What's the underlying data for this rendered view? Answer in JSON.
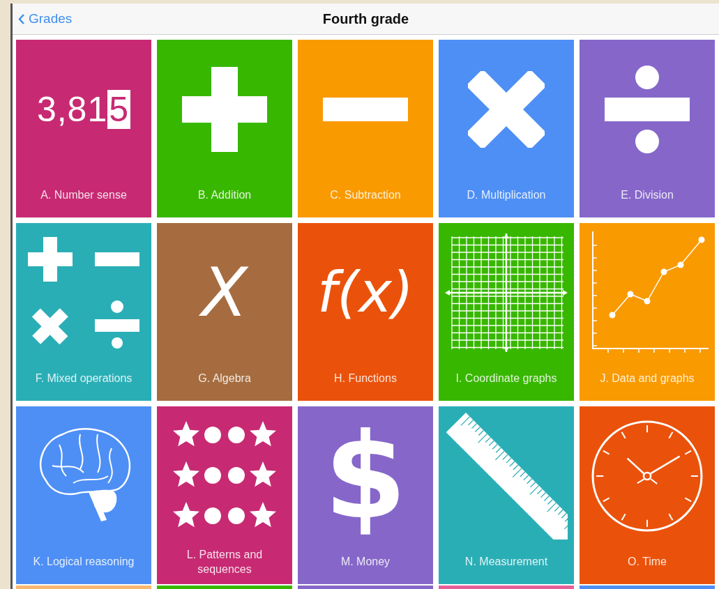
{
  "nav": {
    "back": "Grades",
    "title": "Fourth grade"
  },
  "tiles": [
    {
      "label": "A. Number sense",
      "color": "#c72a72",
      "kind": "number",
      "number": "3,81",
      "highlight": "5"
    },
    {
      "label": "B. Addition",
      "color": "#38b700",
      "kind": "plus"
    },
    {
      "label": "C. Subtraction",
      "color": "#f99a00",
      "kind": "minus"
    },
    {
      "label": "D. Multiplication",
      "color": "#4e8ff5",
      "kind": "times"
    },
    {
      "label": "E. Division",
      "color": "#8667c9",
      "kind": "divide"
    },
    {
      "label": "F. Mixed operations",
      "color": "#2aaeb6",
      "kind": "mixed"
    },
    {
      "label": "G. Algebra",
      "color": "#a66c3f",
      "kind": "symbol",
      "symbol": "X"
    },
    {
      "label": "H. Functions",
      "color": "#ea520b",
      "kind": "symbol",
      "symbol": "f(x)"
    },
    {
      "label": "I. Coordinate graphs",
      "color": "#38b700",
      "kind": "grid"
    },
    {
      "label": "J. Data and graphs",
      "color": "#f99a00",
      "kind": "chart"
    },
    {
      "label": "K. Logical reasoning",
      "color": "#4e8ff5",
      "kind": "brain"
    },
    {
      "label": "L. Patterns and sequences",
      "color": "#c72a72",
      "kind": "pattern"
    },
    {
      "label": "M. Money",
      "color": "#8667c9",
      "kind": "symbol",
      "symbol": "$"
    },
    {
      "label": "N. Measurement",
      "color": "#2aaeb6",
      "kind": "ruler"
    },
    {
      "label": "O. Time",
      "color": "#ea520b",
      "kind": "clock"
    }
  ],
  "partial_tiles": [
    {
      "color": "#f9b870"
    },
    {
      "color": "#38b700"
    },
    {
      "color": "#8667c9"
    },
    {
      "color": "#e8609a"
    },
    {
      "color": "#4e8ff5"
    }
  ]
}
